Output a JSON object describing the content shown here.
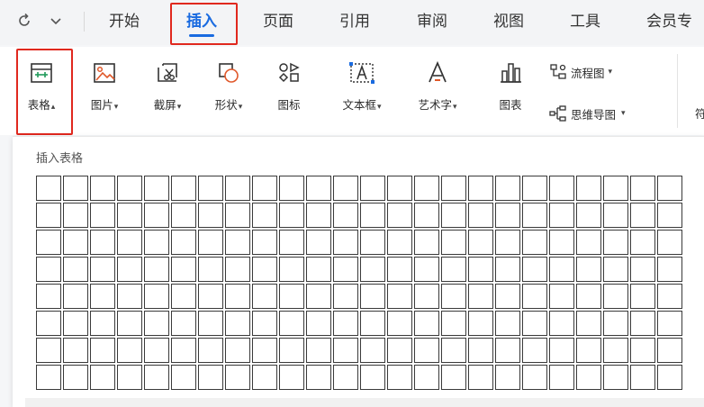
{
  "menu": {
    "tabs": [
      {
        "label": "开始"
      },
      {
        "label": "插入",
        "active": true
      },
      {
        "label": "页面"
      },
      {
        "label": "引用"
      },
      {
        "label": "审阅"
      },
      {
        "label": "视图"
      },
      {
        "label": "工具"
      },
      {
        "label": "会员专"
      }
    ],
    "quick_icons": [
      "refresh-icon",
      "chevron-down-icon"
    ]
  },
  "ribbon": {
    "items": [
      {
        "label": "表格",
        "dropdown": true,
        "icon": "table-icon",
        "highlighted": true
      },
      {
        "label": "图片",
        "dropdown": true,
        "icon": "picture-icon"
      },
      {
        "label": "截屏",
        "dropdown": true,
        "icon": "screenshot-icon"
      },
      {
        "label": "形状",
        "dropdown": true,
        "icon": "shapes-icon"
      },
      {
        "label": "图标",
        "dropdown": false,
        "icon": "icons-icon"
      },
      {
        "label": "文本框",
        "dropdown": true,
        "icon": "textbox-icon"
      },
      {
        "label": "艺术字",
        "dropdown": true,
        "icon": "wordart-icon"
      },
      {
        "label": "图表",
        "dropdown": false,
        "icon": "chart-icon"
      }
    ],
    "flowchart_label": "流程图",
    "mindmap_label": "思维导图",
    "cut_label": "符"
  },
  "panel": {
    "title": "插入表格",
    "grid_columns": 24,
    "grid_rows": 8
  },
  "colors": {
    "accent": "#1a6be0",
    "highlight_box": "#e0281e",
    "ribbon_bg": "#ffffff",
    "menubar_bg": "#f3f4f6"
  }
}
